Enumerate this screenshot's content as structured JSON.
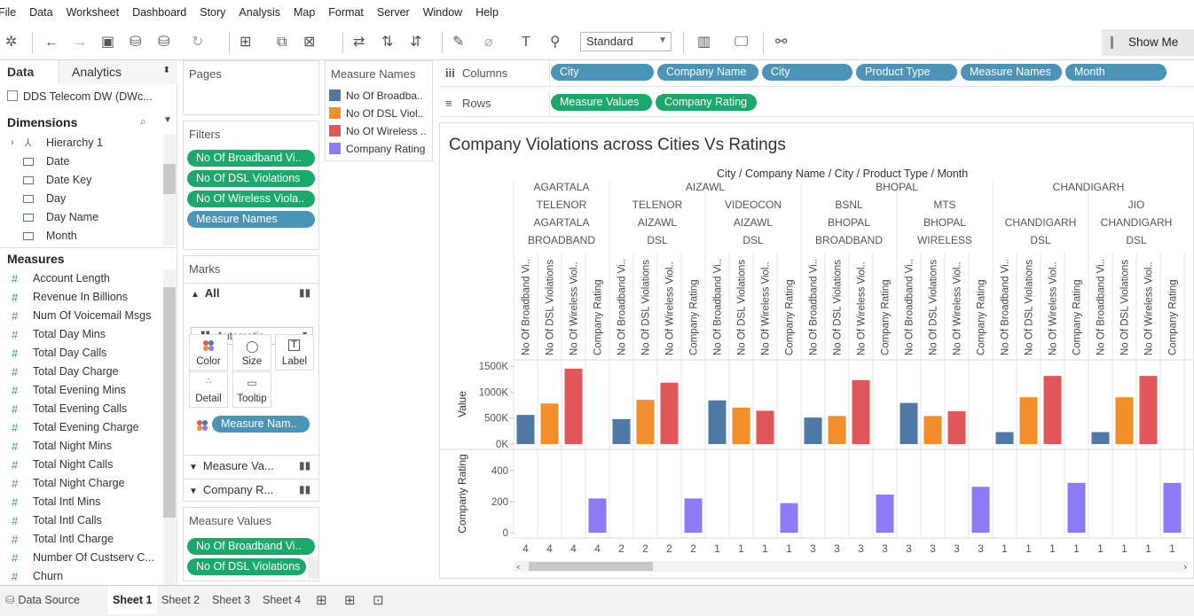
{
  "menu": [
    "File",
    "Data",
    "Worksheet",
    "Dashboard",
    "Story",
    "Analysis",
    "Map",
    "Format",
    "Server",
    "Window",
    "Help"
  ],
  "toolbar": {
    "fit_value": "Standard",
    "show_me_label": "Show Me"
  },
  "data_pane": {
    "tab_data": "Data",
    "tab_analytics": "Analytics",
    "data_source": "DDS Telecom DW (DWc...",
    "dimensions_title": "Dimensions",
    "dimensions": [
      "Hierarchy 1",
      "Date",
      "Date Key",
      "Day",
      "Day Name",
      "Month"
    ],
    "measures_title": "Measures",
    "measures": [
      "Account Length",
      "Revenue In Billions",
      "Num Of Voicemail Msgs",
      "Total Day Mins",
      "Total Day Calls",
      "Total Day Charge",
      "Total Evening Mins",
      "Total Evening Calls",
      "Total Evening Charge",
      "Total Night Mins",
      "Total Night Calls",
      "Total Night Charge",
      "Total Intl Mins",
      "Total Intl Calls",
      "Total Intl Charge",
      "Number Of Custserv C...",
      "Churn"
    ]
  },
  "pages_title": "Pages",
  "filters": {
    "title": "Filters",
    "pills": [
      "No Of Broadband Vi..",
      "No Of DSL Violations",
      "No Of Wireless Viola..",
      "Measure Names"
    ]
  },
  "marks": {
    "title": "Marks",
    "all_label": "All",
    "type": "Automatic",
    "buttons": [
      "Color",
      "Size",
      "Label",
      "Detail",
      "Tooltip"
    ],
    "color_pill": "Measure Nam..",
    "rows": [
      "Measure Va...",
      "Company R..."
    ]
  },
  "measure_values": {
    "title": "Measure Values",
    "pills": [
      "No Of Broadband Vi..",
      "No Of DSL Violations"
    ]
  },
  "legend": {
    "title": "Measure Names",
    "items": [
      {
        "label": "No Of Broadba..",
        "color": "#4e79a7"
      },
      {
        "label": "No Of DSL Viol..",
        "color": "#f28e2b"
      },
      {
        "label": "No Of Wireless ..",
        "color": "#e15759"
      },
      {
        "label": "Company Rating",
        "color": "#8b7cf6"
      }
    ]
  },
  "columns_shelf": {
    "label": "Columns",
    "pills": [
      "City",
      "Company Name",
      "City",
      "Product Type",
      "Measure Names",
      "Month"
    ]
  },
  "rows_shelf": {
    "label": "Rows",
    "pills": [
      "Measure Values",
      "Company Rating"
    ]
  },
  "chart_data": {
    "type": "bar",
    "title": "Company Violations across Cities Vs Ratings",
    "header_path": "City / Company Name / City / Product Type / Month",
    "measure_headers": [
      "No Of Broadband Vi..",
      "No Of DSL Violations",
      "No Of Wireless Viol..",
      "Company Rating"
    ],
    "panes": [
      {
        "city": "AGARTALA",
        "company": "TELENOR",
        "city2": "AGARTALA",
        "product": "BROADBAND",
        "broadband": 560000,
        "dsl": 780000,
        "wireless": 1450000,
        "rating": 220,
        "months": [
          "4",
          "4",
          "4",
          "4"
        ]
      },
      {
        "city": "AIZAWL",
        "company": "TELENOR",
        "city2": "AIZAWL",
        "product": "DSL",
        "broadband": 480000,
        "dsl": 850000,
        "wireless": 1180000,
        "rating": 220,
        "months": [
          "2",
          "2",
          "2",
          "2"
        ]
      },
      {
        "city": "AIZAWL",
        "company": "VIDEOCON",
        "city2": "AIZAWL",
        "product": "DSL",
        "broadband": 840000,
        "dsl": 700000,
        "wireless": 640000,
        "rating": 190,
        "months": [
          "1",
          "1",
          "1",
          "1"
        ]
      },
      {
        "city": "BHOPAL",
        "company": "BSNL",
        "city2": "BHOPAL",
        "product": "BROADBAND",
        "broadband": 510000,
        "dsl": 540000,
        "wireless": 1230000,
        "rating": 245,
        "months": [
          "3",
          "3",
          "3",
          "3"
        ]
      },
      {
        "city": "BHOPAL",
        "company": "MTS",
        "city2": "BHOPAL",
        "product": "WIRELESS",
        "broadband": 790000,
        "dsl": 540000,
        "wireless": 630000,
        "rating": 295,
        "months": [
          "3",
          "3",
          "3",
          "3"
        ]
      },
      {
        "city": "CHANDIGARH",
        "company": "",
        "city2": "CHANDIGARH",
        "product": "DSL",
        "broadband": 230000,
        "dsl": 900000,
        "wireless": 1310000,
        "rating": 320,
        "months": [
          "1",
          "1",
          "1",
          "1"
        ]
      },
      {
        "city": "CHANDIGARH",
        "company": "JIO",
        "city2": "CHANDIGARH",
        "product": "DSL",
        "broadband": 230000,
        "dsl": 900000,
        "wireless": 1310000,
        "rating": 320,
        "months": [
          "1",
          "1",
          "1",
          "1"
        ]
      }
    ],
    "value_axis": {
      "label": "Value",
      "ticks": [
        "1500K",
        "1000K",
        "500K",
        "0K"
      ],
      "ylim": [
        0,
        1500000
      ]
    },
    "rating_axis": {
      "label": "Company Rating",
      "ticks": [
        "400",
        "200",
        "0"
      ],
      "ylim": [
        0,
        450
      ]
    }
  },
  "bottom_tabs": [
    "Data Source",
    "Sheet 1",
    "Sheet 2",
    "Sheet 3",
    "Sheet 4"
  ]
}
